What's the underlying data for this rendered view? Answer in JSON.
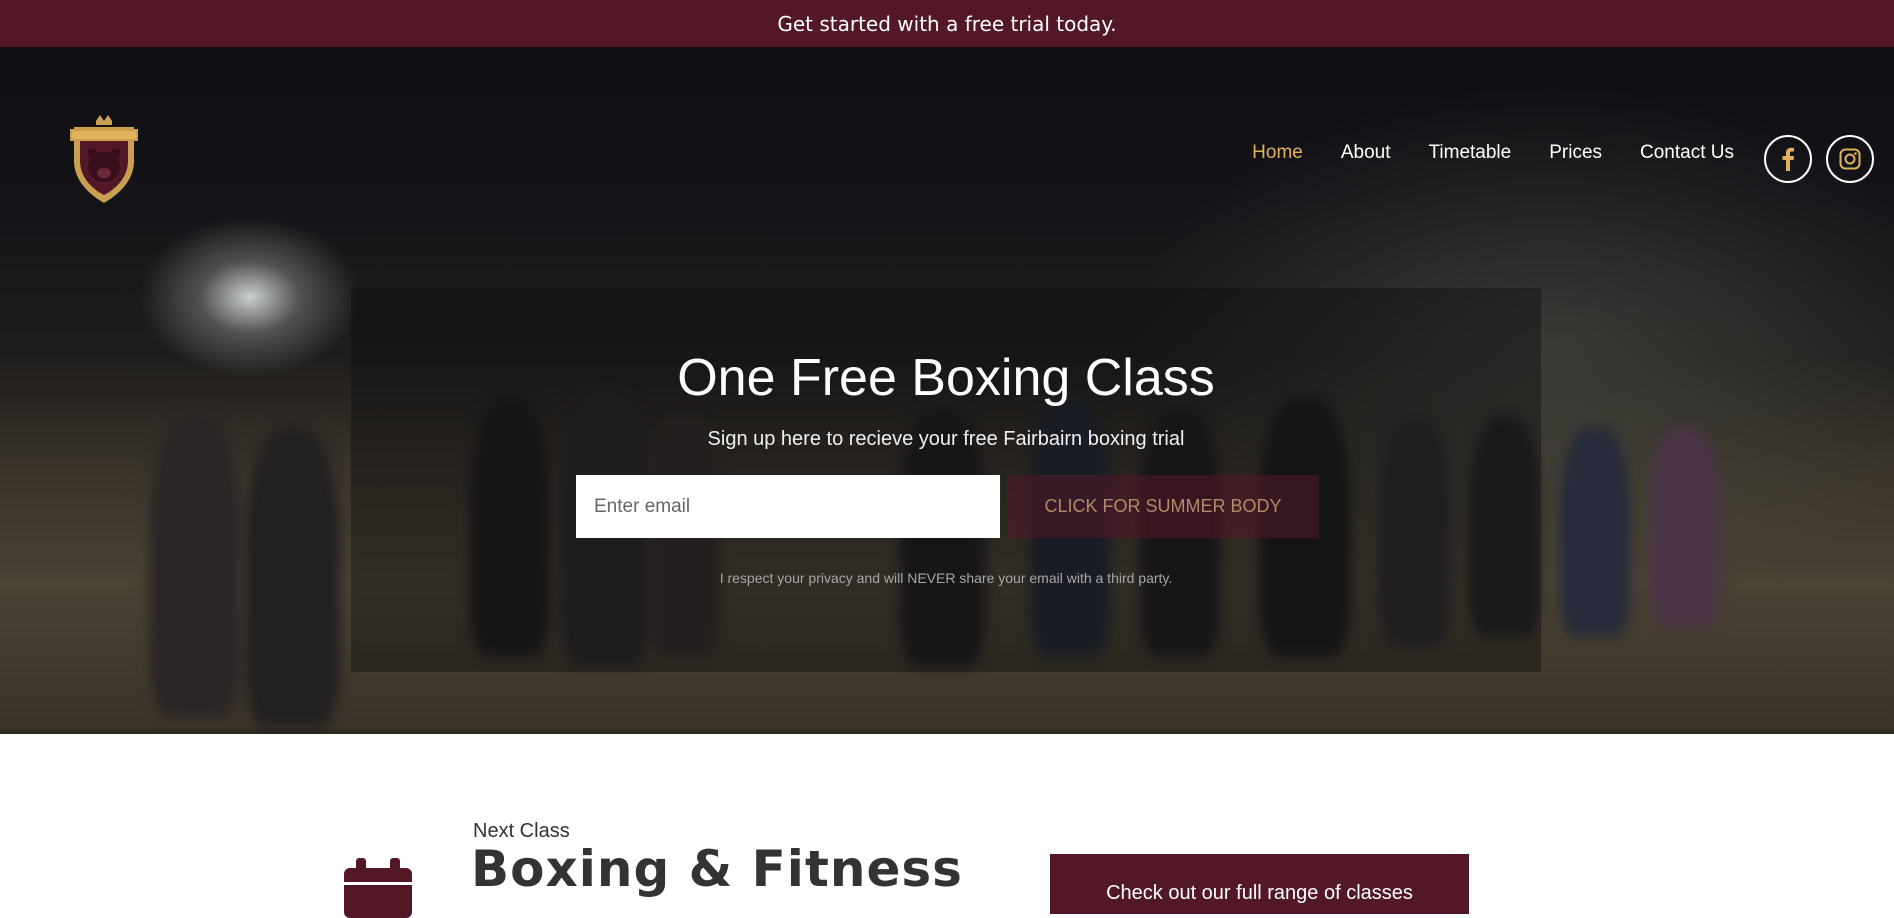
{
  "announcement": {
    "text": "Get started with a free trial today."
  },
  "header": {
    "logo": {
      "name": "fairbairn-logo"
    },
    "nav": [
      {
        "label": "Home",
        "active": true
      },
      {
        "label": "About",
        "active": false
      },
      {
        "label": "Timetable",
        "active": false
      },
      {
        "label": "Prices",
        "active": false
      },
      {
        "label": "Contact Us",
        "active": false
      }
    ],
    "social": [
      {
        "icon": "facebook-icon"
      },
      {
        "icon": "instagram-icon"
      }
    ]
  },
  "signup": {
    "title": "One Free Boxing Class",
    "subtitle": "Sign up here to recieve your free Fairbairn boxing trial",
    "email_placeholder": "Enter email",
    "button_label": "CLICK FOR SUMMER BODY",
    "privacy_note": "I respect your privacy and will NEVER share your email with a third party."
  },
  "next_class": {
    "label": "Next Class",
    "title": "Boxing & Fitness",
    "icon": "calendar-icon",
    "button_label": "Check out our full range of classes"
  },
  "colors": {
    "brand": "#521828",
    "accent_gold": "#e0b25c",
    "text_dark": "#333333"
  }
}
